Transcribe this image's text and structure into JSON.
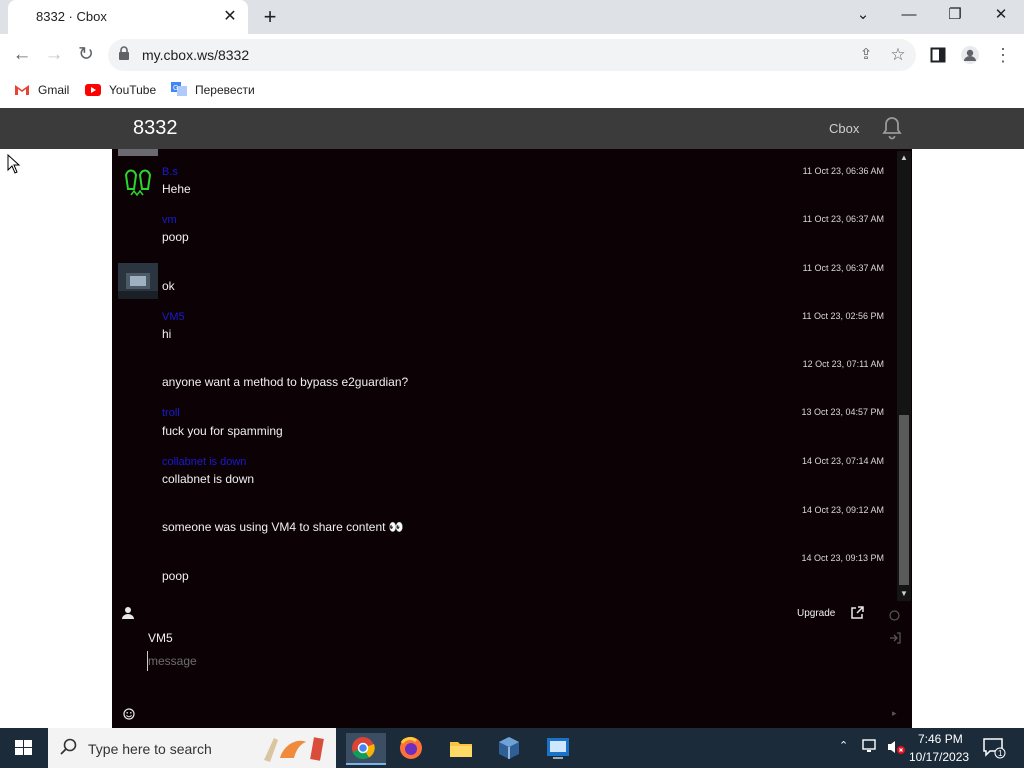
{
  "browser": {
    "tab_title": "8332 · Cbox",
    "url": "my.cbox.ws/8332",
    "bookmarks": [
      "Gmail",
      "YouTube",
      "Перевести"
    ]
  },
  "cbox": {
    "title": "8332",
    "brand": "Cbox",
    "messages": [
      {
        "user": "B.s",
        "time": "11 Oct 23, 06:36 AM",
        "text": "Hehe"
      },
      {
        "user": "vm",
        "time": "11 Oct 23, 06:37 AM",
        "text": "poop"
      },
      {
        "user": "",
        "time": "11 Oct 23, 06:37 AM",
        "text": "ok"
      },
      {
        "user": "VM5",
        "time": "11 Oct 23, 02:56 PM",
        "text": "hi"
      },
      {
        "user": "",
        "time": "12 Oct 23, 07:11 AM",
        "text": "anyone want a method to bypass e2guardian?"
      },
      {
        "user": "troll",
        "time": "13 Oct 23, 04:57 PM",
        "text": "fuck you for spamming"
      },
      {
        "user": "collabnet is down",
        "time": "14 Oct 23, 07:14 AM",
        "text": "collabnet is down"
      },
      {
        "user": "",
        "time": "14 Oct 23, 09:12 AM",
        "text": "someone was using VM4 to share content 👀"
      },
      {
        "user": "",
        "time": "14 Oct 23, 09:13 PM",
        "text": "poop"
      }
    ],
    "composer": {
      "name": "VM5",
      "placeholder": "message",
      "upgrade_label": "Upgrade"
    }
  },
  "taskbar": {
    "search_placeholder": "Type here to search",
    "time": "7:46 PM",
    "date": "10/17/2023"
  }
}
